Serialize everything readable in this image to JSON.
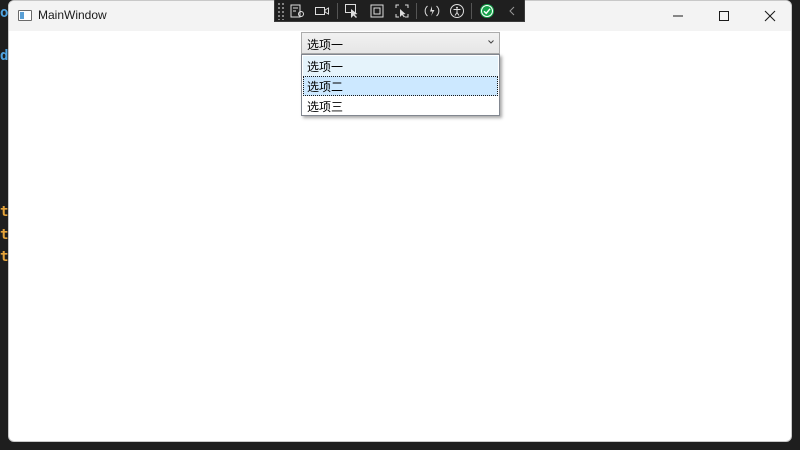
{
  "window": {
    "title": "MainWindow"
  },
  "debug_toolbar": {
    "buttons": [
      {
        "icon": "visual-tree-icon"
      },
      {
        "icon": "video-camera-icon"
      },
      {
        "icon": "select-element-icon"
      },
      {
        "icon": "display-layout-adorners-icon"
      },
      {
        "icon": "track-focus-icon"
      },
      {
        "icon": "hot-reload-icon"
      },
      {
        "icon": "accessibility-icon"
      },
      {
        "icon": "check-circle-icon"
      },
      {
        "icon": "collapse-chevron-icon"
      }
    ],
    "accent": "#16a34a"
  },
  "combo": {
    "selected_value": "选项一",
    "options": [
      {
        "label": "选项一",
        "state": "hover"
      },
      {
        "label": "选项二",
        "state": "selected"
      },
      {
        "label": "选项三",
        "state": "normal"
      }
    ]
  },
  "background_editor": {
    "glyphs": [
      "o",
      "d",
      "t",
      "t",
      "t"
    ]
  },
  "colors": {
    "selection": "#cce8ff",
    "hover": "#e5f3fb",
    "window_bg": "#ffffff",
    "titlebar_bg": "#f3f3f3"
  }
}
